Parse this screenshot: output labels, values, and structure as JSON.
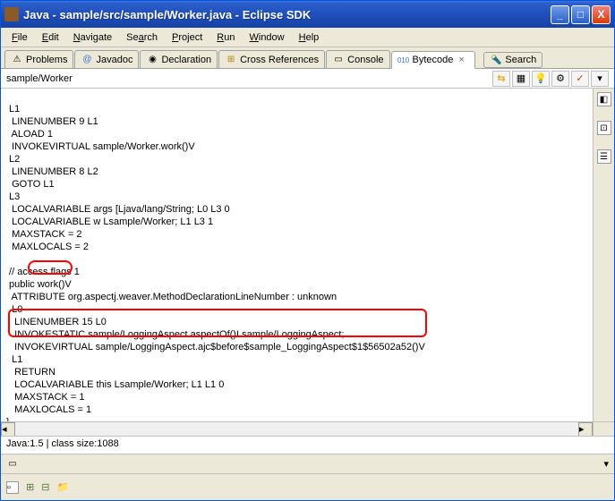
{
  "window": {
    "title": "Java - sample/src/sample/Worker.java - Eclipse SDK"
  },
  "menu": {
    "file": "File",
    "edit": "Edit",
    "navigate": "Navigate",
    "search": "Search",
    "project": "Project",
    "run": "Run",
    "window": "Window",
    "help": "Help"
  },
  "tabs": {
    "problems": "Problems",
    "javadoc": "Javadoc",
    "declaration": "Declaration",
    "crossrefs": "Cross References",
    "console": "Console",
    "bytecode": "Bytecode",
    "search": "Search"
  },
  "toolbar": {
    "path": "sample/Worker"
  },
  "code": {
    "l1": " L1",
    "ln1": "  LINENUMBER 9 L1",
    "aload": "  ALOAD 1",
    "invoke1": "  INVOKEVIRTUAL sample/Worker.work()V",
    "l2": " L2",
    "ln2": "  LINENUMBER 8 L2",
    "goto": "  GOTO L1",
    "l3": " L3",
    "lv1": "  LOCALVARIABLE args [Ljava/lang/String; L0 L3 0",
    "lv2": "  LOCALVARIABLE w Lsample/Worker; L1 L3 1",
    "ms2": "  MAXSTACK = 2",
    "ml2": "  MAXLOCALS = 2",
    "blank1": "",
    "af": " // access flags 1",
    "pw": " public work()V",
    "attr": "  ATTRIBUTE org.aspectj.weaver.MethodDeclarationLineNumber : unknown",
    "l0": "  L0",
    "ln15": "   LINENUMBER 15 L0",
    "is": "   INVOKESTATIC sample/LoggingAspect.aspectOf()Lsample/LoggingAspect;",
    "iv": "   INVOKEVIRTUAL sample/LoggingAspect.ajc$before$sample_LoggingAspect$1$56502a52()V",
    "l1b": "  L1",
    "ret": "   RETURN",
    "lv3": "   LOCALVARIABLE this Lsample/Worker; L1 L1 0",
    "ms1": "   MAXSTACK = 1",
    "ml1": "   MAXLOCALS = 1",
    "brace": "}"
  },
  "status": {
    "text": "Java:1.5 | class size:1088"
  }
}
